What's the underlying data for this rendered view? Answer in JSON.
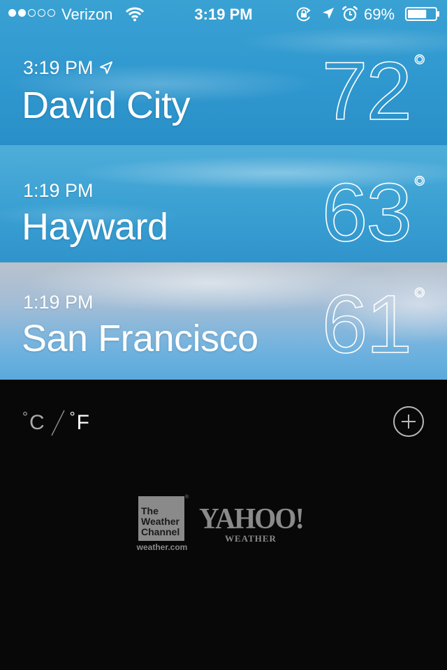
{
  "status_bar": {
    "signal_bars_filled": 2,
    "signal_bars_total": 5,
    "carrier": "Verizon",
    "time": "3:19 PM",
    "battery_percent": "69%",
    "battery_level": 0.69,
    "icons": [
      "wifi-icon",
      "rotation-lock-icon",
      "location-arrow-icon",
      "alarm-clock-icon",
      "battery-icon"
    ]
  },
  "cities": [
    {
      "time": "3:19 PM",
      "name": "David City",
      "temperature": "72",
      "degree": "°",
      "current_location": true
    },
    {
      "time": "1:19 PM",
      "name": "Hayward",
      "temperature": "63",
      "degree": "°",
      "current_location": false
    },
    {
      "time": "1:19 PM",
      "name": "San Francisco",
      "temperature": "61",
      "degree": "°",
      "current_location": false
    }
  ],
  "units": {
    "celsius": "C",
    "fahrenheit": "F",
    "degree": "°",
    "selected": "F"
  },
  "add_button_icon": "plus-circle-icon",
  "logos": {
    "weather_channel": "The\nWeather\nChannel",
    "weather_channel_url": "weather.com",
    "yahoo": "YAHOO!",
    "yahoo_sub": "WEATHER"
  }
}
